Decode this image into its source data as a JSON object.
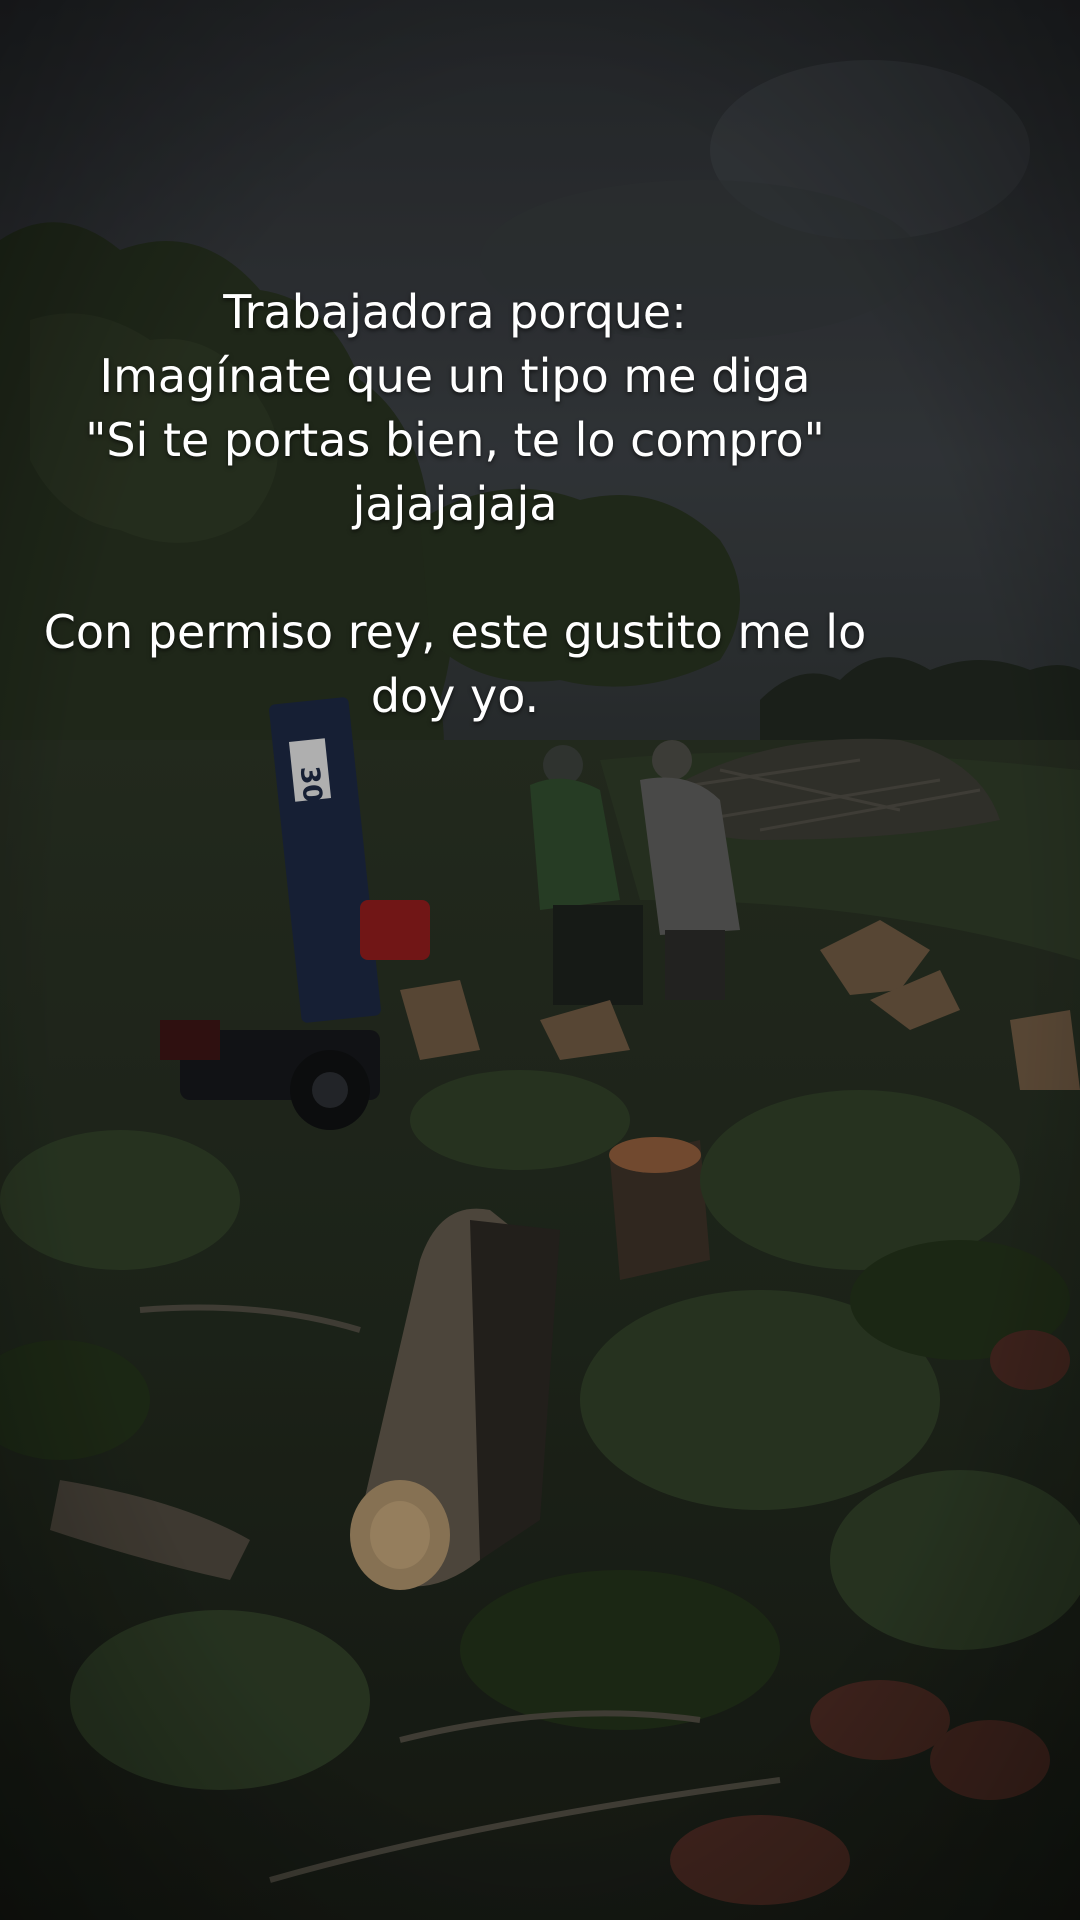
{
  "caption": {
    "lines_top": [
      "Trabajadora porque:",
      "Imagínate que un tipo me diga",
      "\"Si te portas bien, te lo compro\"",
      "jajajajaja"
    ],
    "lines_bottom": [
      "Con permiso rey, este gustito me lo",
      "doy yo."
    ]
  },
  "machine": {
    "label": "30"
  }
}
